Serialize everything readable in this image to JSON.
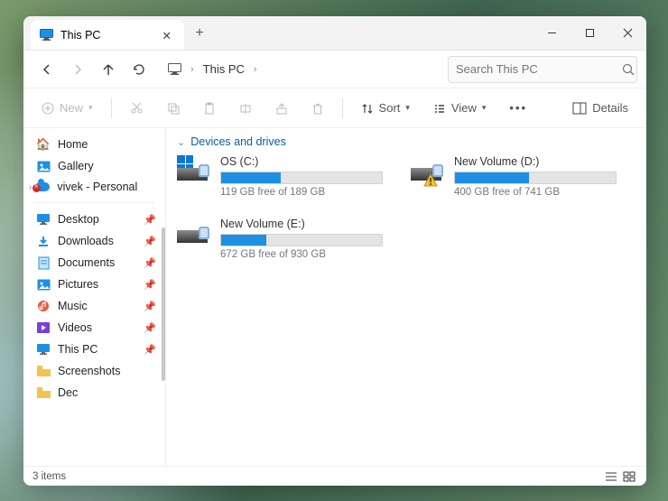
{
  "tab": {
    "title": "This PC"
  },
  "breadcrumb": {
    "location": "This PC"
  },
  "search": {
    "placeholder": "Search This PC"
  },
  "toolbar": {
    "new": "New",
    "sort": "Sort",
    "view": "View",
    "details": "Details"
  },
  "sidebar": {
    "home": "Home",
    "gallery": "Gallery",
    "cloud": "vivek - Personal",
    "quick": {
      "desktop": "Desktop",
      "downloads": "Downloads",
      "documents": "Documents",
      "pictures": "Pictures",
      "music": "Music",
      "videos": "Videos",
      "thispc": "This PC",
      "screenshots": "Screenshots",
      "dec": "Dec"
    }
  },
  "group_header": "Devices and drives",
  "drives": [
    {
      "name": "OS (C:)",
      "free": "119 GB free of 189 GB",
      "fill": 37,
      "winlogo": true,
      "warn": false
    },
    {
      "name": "New Volume (D:)",
      "free": "400 GB free of 741 GB",
      "fill": 46,
      "winlogo": false,
      "warn": true
    },
    {
      "name": "New Volume (E:)",
      "free": "672 GB free of 930 GB",
      "fill": 28,
      "winlogo": false,
      "warn": false
    }
  ],
  "status": {
    "items": "3 items"
  }
}
